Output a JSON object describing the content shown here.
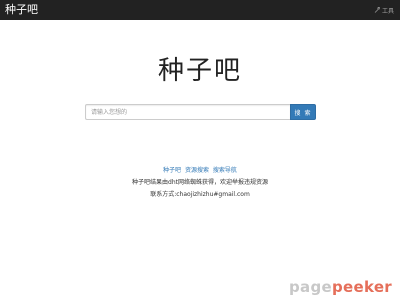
{
  "navbar": {
    "brand": "种子吧",
    "tools_label": "工具",
    "tools_icon": "wrench-icon"
  },
  "main": {
    "title": "种子吧",
    "search": {
      "placeholder": "请输入您想的",
      "value": "",
      "button_label": "搜 索"
    }
  },
  "footer": {
    "links": [
      {
        "label": "种子吧"
      },
      {
        "label": "资源搜索"
      },
      {
        "label": "搜索导航"
      }
    ],
    "note": "种子吧结果由dht网络蜘蛛获得，欢迎举报违规资源",
    "contact": "联系方式:chaojizhizhu#gmail.com"
  },
  "watermark": {
    "part1": "page",
    "part2": "peeker"
  },
  "colors": {
    "navbar_bg": "#222222",
    "accent": "#337ab7",
    "watermark_gray": "#c8c8c8",
    "watermark_red": "#e56f5a"
  }
}
